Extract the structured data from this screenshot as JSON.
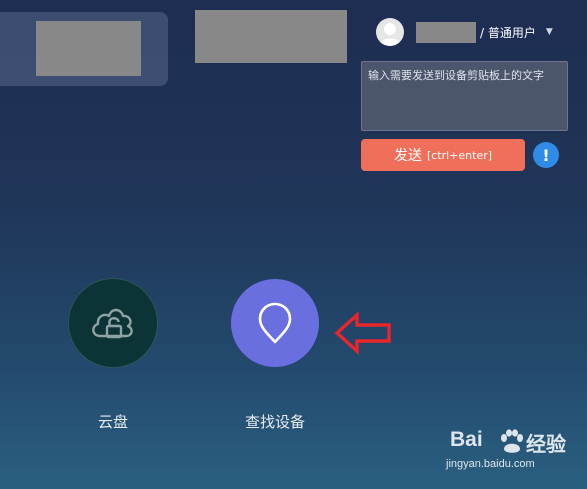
{
  "user": {
    "role": "/ 普通用户"
  },
  "clipboard": {
    "placeholder": "输入需要发送到设备剪贴板上的文字",
    "send_label": "发送",
    "send_shortcut": "[ctrl+enter]",
    "info_label": "!"
  },
  "apps": [
    {
      "label": "云盘",
      "icon": "cloud-lock-icon",
      "color": "#0c3437"
    },
    {
      "label": "查找设备",
      "icon": "location-pin-icon",
      "color": "#6a6fe0"
    }
  ],
  "watermark": {
    "brand": "Bai",
    "brand_cn": "经验",
    "url": "jingyan.baidu.com"
  },
  "colors": {
    "send_button": "#ef6f5a",
    "info_button": "#2f8be6",
    "arrow": "#e8262b"
  }
}
